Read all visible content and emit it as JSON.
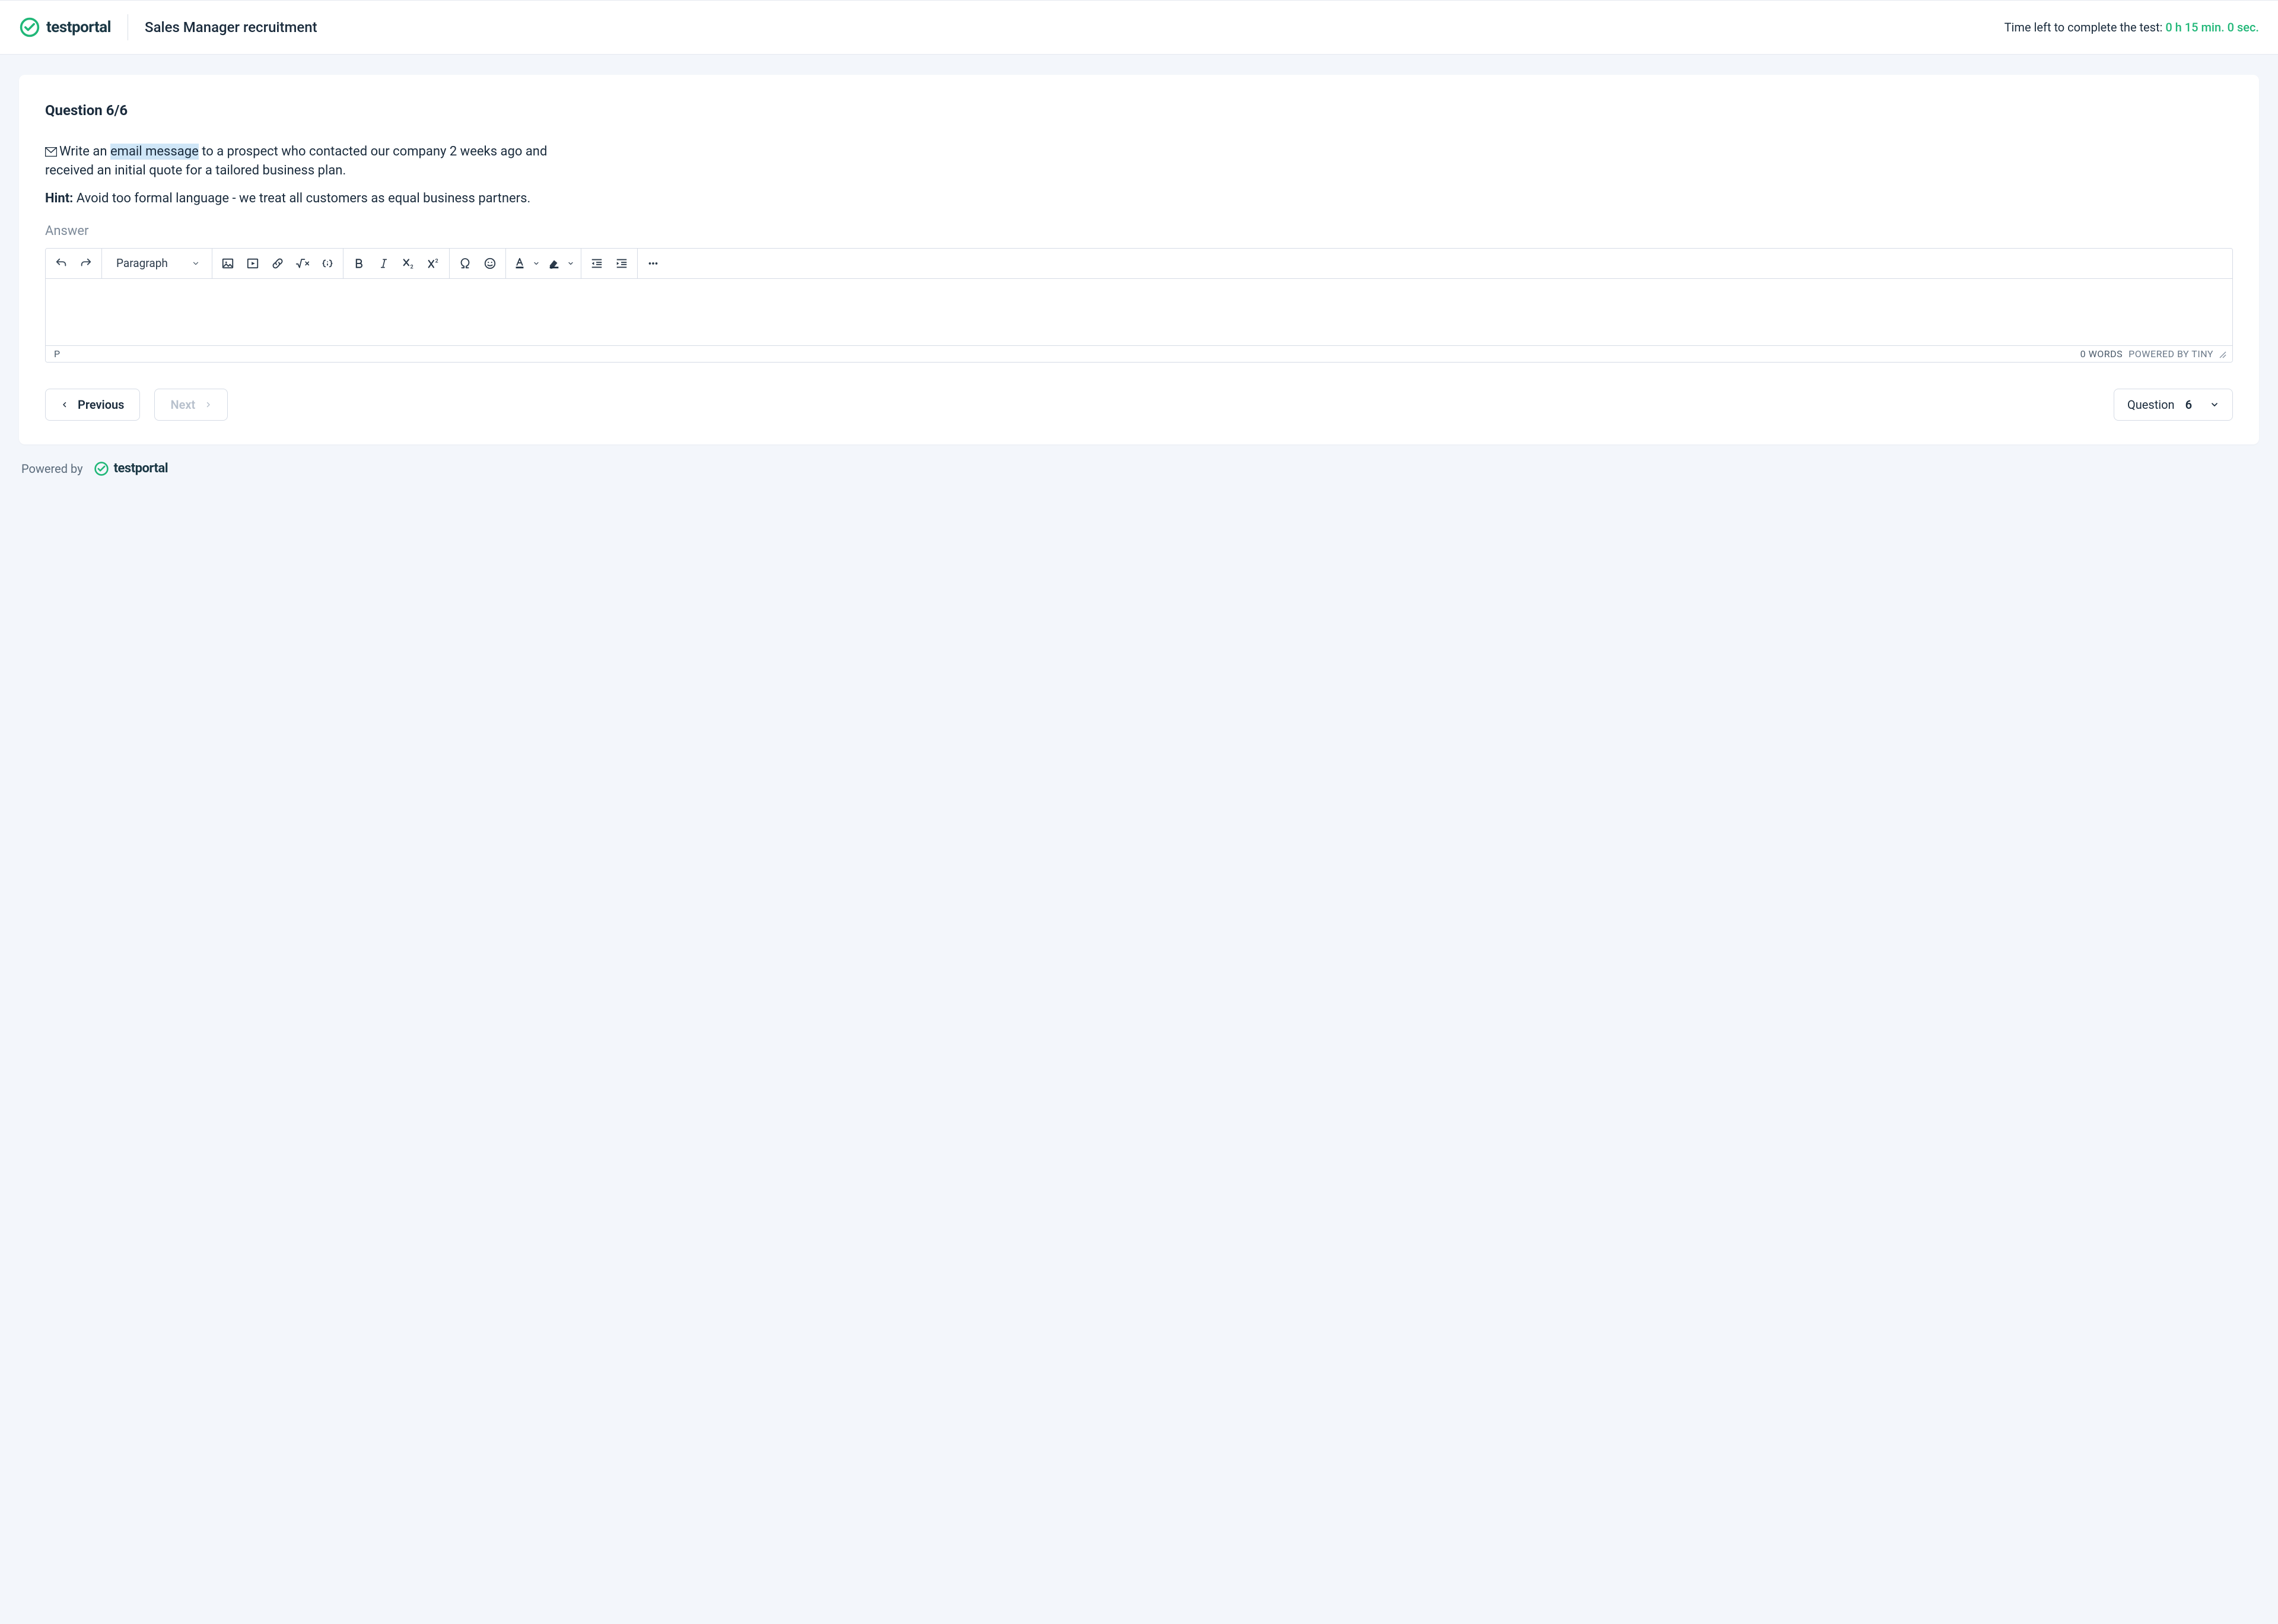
{
  "brand": {
    "name": "testportal"
  },
  "header": {
    "test_title": "Sales Manager recruitment",
    "timer_label": "Time left to complete the test: ",
    "timer_value": "0 h 15 min. 0 sec."
  },
  "question": {
    "heading": "Question 6/6",
    "text_before": "Write an ",
    "text_highlight": "email message",
    "text_after": " to a prospect who contacted our company 2 weeks ago and received an initial quote for a tailored business plan.",
    "hint_label": "Hint:",
    "hint_text": " Avoid too formal language - we treat all customers as equal business partners.",
    "answer_label": "Answer"
  },
  "editor": {
    "format_label": "Paragraph",
    "path": "P",
    "word_count": "0 WORDS",
    "powered": "POWERED BY TINY"
  },
  "nav": {
    "prev": "Previous",
    "next": "Next",
    "selector_label": "Question",
    "selector_value": "6"
  },
  "footer": {
    "powered_by": "Powered by"
  }
}
